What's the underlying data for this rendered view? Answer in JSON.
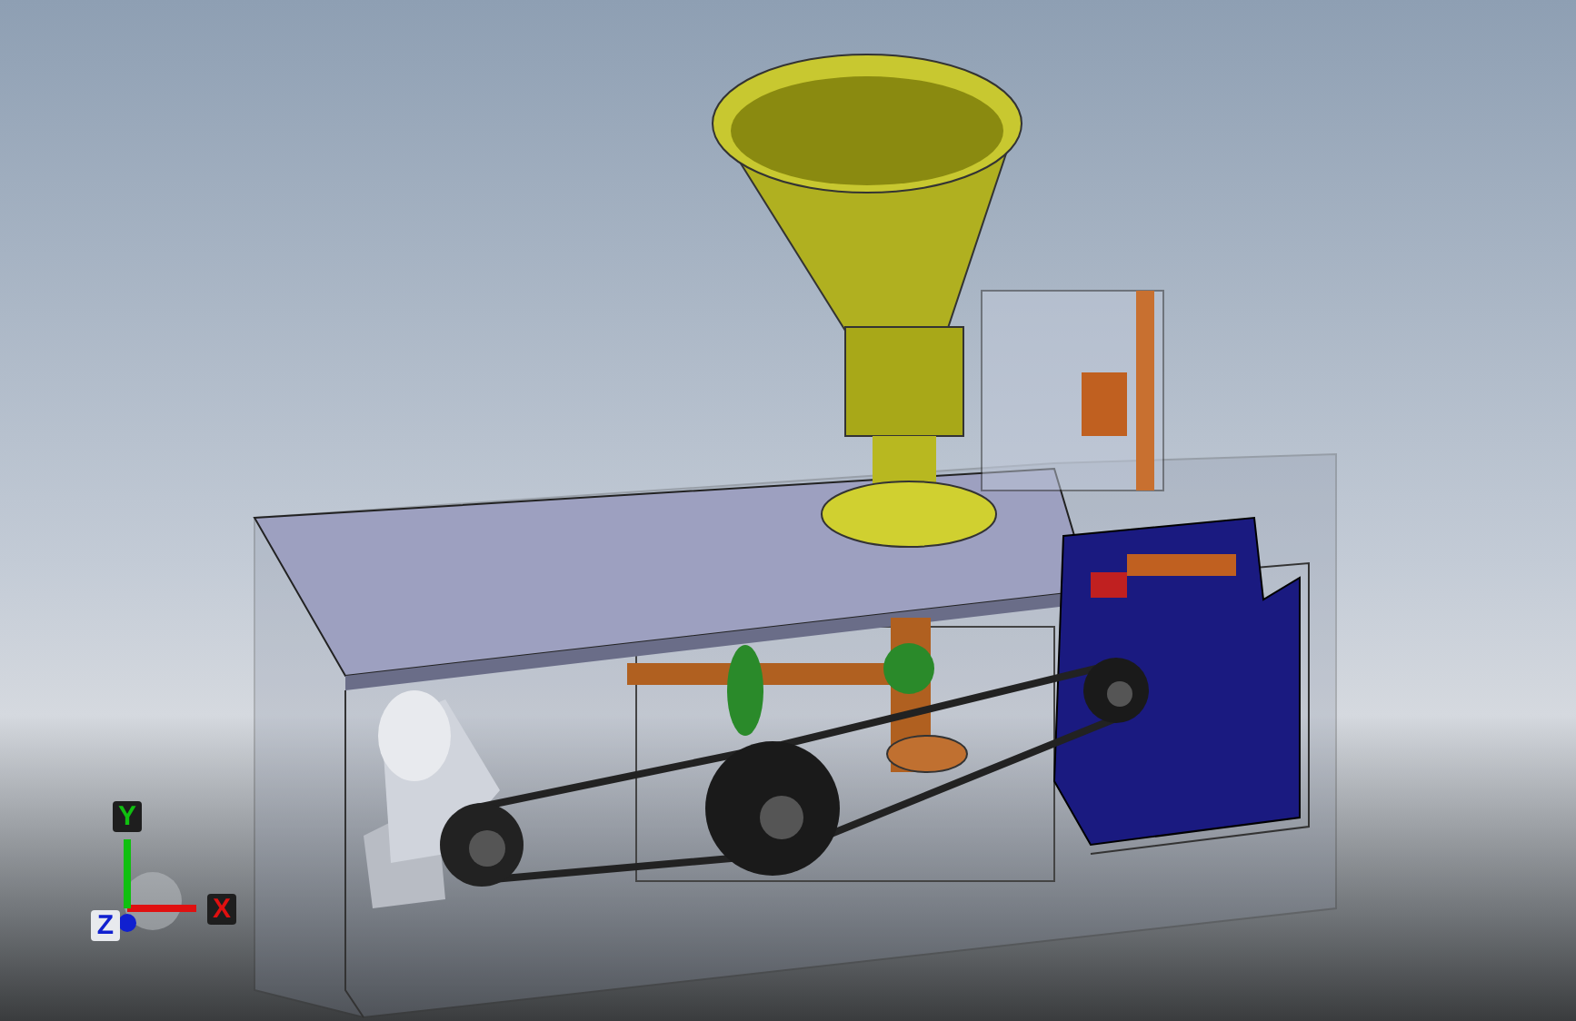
{
  "viewport": {
    "axis_triad": [
      {
        "label": "X",
        "color": "#e01010"
      },
      {
        "label": "Y",
        "color": "#10c010"
      },
      {
        "label": "Z",
        "color": "#1020d0"
      }
    ]
  }
}
